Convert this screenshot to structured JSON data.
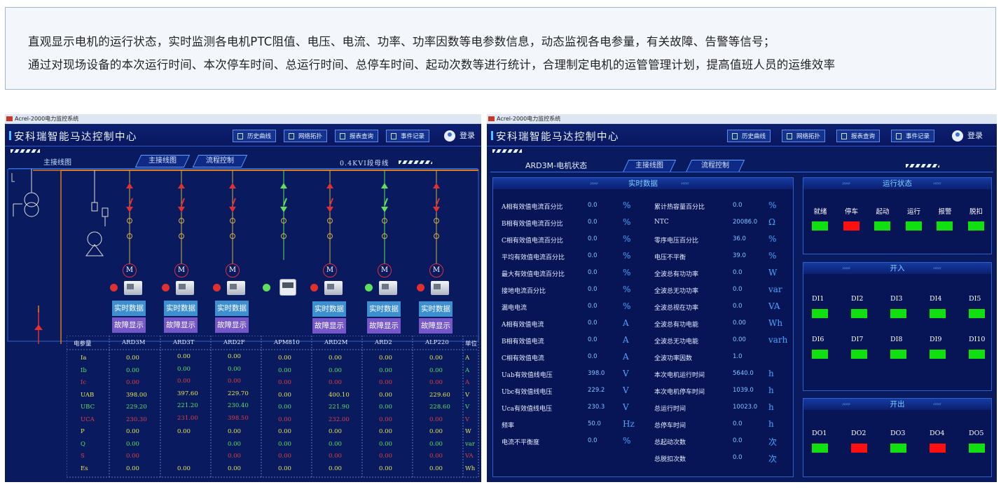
{
  "intro": {
    "line1": "直观显示电机的运行状态，实时监测各电机PTC阻值、电压、电流、功率、功率因数等电参数信息，动态监视各电参量，有关故障、告警等信号；",
    "line2": "通过对现场设备的本次运行时间、本次停车时间、总运行时间、总停车时间、起动次数等进行统计，合理制定电机的运管管理计划，提高值班人员的运维效率"
  },
  "window_title": "Acrel-2000电力监控系统",
  "header": {
    "title": "安科瑞智能马达控制中心",
    "buttons": [
      "历史曲线",
      "网络拓扑",
      "报表查询",
      "事件记录"
    ],
    "login": "登录"
  },
  "left": {
    "active_tab": "主接线图",
    "tabs": [
      "主接线图",
      "流程控制"
    ],
    "bus_label": "0.4KVⅠ段母线",
    "motor_glyph": "M",
    "button_realtime": "实时数据",
    "button_fault": "故障显示",
    "table": {
      "header_param": "电参量",
      "header_unit": "单位",
      "columns": [
        "ARD3M",
        "ARD3T",
        "ARD2F",
        "APM810",
        "ARD2M",
        "ARD2",
        "ALP220"
      ],
      "rows": [
        {
          "name": "Ia",
          "color": "#e6e65a",
          "unit": "A",
          "values": [
            "0.00",
            "0.00",
            "0.00",
            "0.00",
            "0.00",
            "0.00",
            "0.00"
          ]
        },
        {
          "name": "Ib",
          "color": "#5fe05f",
          "unit": "A",
          "values": [
            "0.00",
            "0.00",
            "0.00",
            "0.00",
            "0.00",
            "0.00",
            "0.00"
          ]
        },
        {
          "name": "Ic",
          "color": "#e04040",
          "unit": "A",
          "values": [
            "0.00",
            "0.00",
            "0.00",
            "0.00",
            "0.00",
            "0.00",
            "0.00"
          ]
        },
        {
          "name": "UAB",
          "color": "#e6e65a",
          "unit": "V",
          "values": [
            "398.00",
            "397.60",
            "229.70",
            "0.00",
            "400.10",
            "0.00",
            "229.60"
          ]
        },
        {
          "name": "UBC",
          "color": "#5fe05f",
          "unit": "V",
          "values": [
            "229.20",
            "221.20",
            "230.40",
            "0.00",
            "221.90",
            "0.00",
            "228.60"
          ]
        },
        {
          "name": "UCA",
          "color": "#e04040",
          "unit": "V",
          "values": [
            "230.30",
            "231.00",
            "398.50",
            "0.00",
            "232.00",
            "0.00",
            "0.00"
          ]
        },
        {
          "name": "P",
          "color": "#e6e65a",
          "unit": "W",
          "values": [
            "0.00",
            "0.00",
            "0.00",
            "0.00",
            "0.00",
            "0.00",
            "0.00"
          ]
        },
        {
          "name": "Q",
          "color": "#5fe05f",
          "unit": "var",
          "values": [
            "0.00",
            "",
            "0.00",
            "0.00",
            "0.00",
            "0.00",
            "0.00"
          ]
        },
        {
          "name": "S",
          "color": "#e04040",
          "unit": "VA",
          "values": [
            "0.00",
            "",
            "0.00",
            "0.00",
            "0.00",
            "0.00",
            "0.00"
          ]
        },
        {
          "name": "Es",
          "color": "#e6e65a",
          "unit": "Wh",
          "values": [
            "0.00",
            "0.00",
            "0.00",
            "0.00",
            "0.00",
            "0.00",
            "0.00"
          ]
        }
      ]
    }
  },
  "right": {
    "active_tab": "ARD3M-电机状态",
    "tabs": [
      "主接线图",
      "流程控制"
    ],
    "realtime": {
      "title": "实时数据",
      "left_rows": [
        {
          "label": "A相有效值电流百分比",
          "value": "0.0",
          "unit": "%"
        },
        {
          "label": "B相有效值电流百分比",
          "value": "0.0",
          "unit": "%"
        },
        {
          "label": "C相有效值电流百分比",
          "value": "0.0",
          "unit": "%"
        },
        {
          "label": "平均有效值电流百分比",
          "value": "0.0",
          "unit": "%"
        },
        {
          "label": "最大有效值电流百分比",
          "value": "0.0",
          "unit": "%"
        },
        {
          "label": "接地电流百分比",
          "value": "0.0",
          "unit": "%"
        },
        {
          "label": "漏电电流",
          "value": "0.0",
          "unit": "%"
        },
        {
          "label": "A相有效值电流",
          "value": "0.0",
          "unit": "A"
        },
        {
          "label": "B相有效值电流",
          "value": "0.0",
          "unit": "A"
        },
        {
          "label": "C相有效值电流",
          "value": "0.0",
          "unit": "A"
        },
        {
          "label": "Uab有效值线电压",
          "value": "398.0",
          "unit": "V"
        },
        {
          "label": "Ubc有效值线电压",
          "value": "229.2",
          "unit": "V"
        },
        {
          "label": "Uca有效值线电压",
          "value": "230.3",
          "unit": "V"
        },
        {
          "label": "频率",
          "value": "50.0",
          "unit": "Hz"
        },
        {
          "label": "电流不平衡度",
          "value": "0.0",
          "unit": "%"
        }
      ],
      "right_rows": [
        {
          "label": "累计热容量百分比",
          "value": "0.0",
          "unit": "%"
        },
        {
          "label": "NTC",
          "value": "20086.0",
          "unit": "Ω"
        },
        {
          "label": "零序电压百分比",
          "value": "36.0",
          "unit": "%"
        },
        {
          "label": "电压不平衡",
          "value": "39.0",
          "unit": "%"
        },
        {
          "label": "全波总有功功率",
          "value": "0.0",
          "unit": "W"
        },
        {
          "label": "全波总无功功率",
          "value": "0.0",
          "unit": "var"
        },
        {
          "label": "全波总视在功率",
          "value": "0.0",
          "unit": "VA"
        },
        {
          "label": "全波总有功电能",
          "value": "0.00",
          "unit": "Wh"
        },
        {
          "label": "全波总无功电能",
          "value": "0.00",
          "unit": "varh"
        },
        {
          "label": "全波功率因数",
          "value": "1.0",
          "unit": ""
        },
        {
          "label": "本次电机运行时间",
          "value": "5640.0",
          "unit": "h"
        },
        {
          "label": "本次电机停车时间",
          "value": "1039.0",
          "unit": "h"
        },
        {
          "label": "总运行时间",
          "value": "10023.0",
          "unit": "h"
        },
        {
          "label": "总停车时间",
          "value": "0.0",
          "unit": "h"
        },
        {
          "label": "总起动次数",
          "value": "0.0",
          "unit": "次"
        },
        {
          "label": "总脱扣次数",
          "value": "0.0",
          "unit": "次"
        }
      ]
    },
    "run_status": {
      "title": "运行状态",
      "items": [
        {
          "label": "就绪",
          "color": "#10e010"
        },
        {
          "label": "停车",
          "color": "#ff1010"
        },
        {
          "label": "起动",
          "color": "#10e010"
        },
        {
          "label": "运行",
          "color": "#10e010"
        },
        {
          "label": "报警",
          "color": "#10e010"
        },
        {
          "label": "脱扣",
          "color": "#10e010"
        }
      ]
    },
    "inputs": {
      "title": "开入",
      "items": [
        {
          "label": "DI1",
          "color": "#10e010"
        },
        {
          "label": "DI2",
          "color": "#10e010"
        },
        {
          "label": "DI3",
          "color": "#10e010"
        },
        {
          "label": "DI4",
          "color": "#10e010"
        },
        {
          "label": "DI5",
          "color": "#10e010"
        },
        {
          "label": "DI6",
          "color": "#10e010"
        },
        {
          "label": "DI7",
          "color": "#10e010"
        },
        {
          "label": "DI8",
          "color": "#10e010"
        },
        {
          "label": "DI9",
          "color": "#10e010"
        },
        {
          "label": "DI10",
          "color": "#10e010"
        }
      ]
    },
    "outputs": {
      "title": "开出",
      "items": [
        {
          "label": "DO1",
          "color": "#10e010"
        },
        {
          "label": "DO2",
          "color": "#ff1010"
        },
        {
          "label": "DO3",
          "color": "#10e010"
        },
        {
          "label": "DO4",
          "color": "#ff1010"
        },
        {
          "label": "DO5",
          "color": "#10e010"
        }
      ]
    }
  }
}
